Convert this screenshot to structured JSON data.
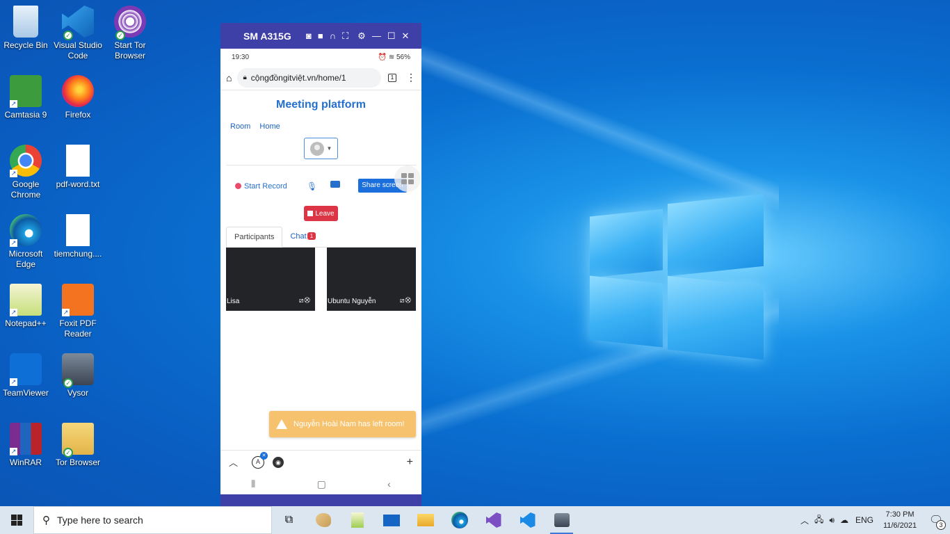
{
  "desktop": {
    "icons": [
      {
        "label": "Recycle Bin",
        "icon": "recycle-bin-icon"
      },
      {
        "label": "Visual Studio Code",
        "icon": "vscode-icon"
      },
      {
        "label": "Start Tor Browser",
        "icon": "tor-browser-icon"
      },
      {
        "label": "Camtasia 9",
        "icon": "camtasia-icon"
      },
      {
        "label": "Firefox",
        "icon": "firefox-icon"
      },
      {
        "label": "Google Chrome",
        "icon": "chrome-icon"
      },
      {
        "label": "pdf-word.txt",
        "icon": "text-file-icon"
      },
      {
        "label": "Microsoft Edge",
        "icon": "edge-icon"
      },
      {
        "label": "tiemchung....",
        "icon": "file-icon"
      },
      {
        "label": "Notepad++",
        "icon": "notepadpp-icon"
      },
      {
        "label": "Foxit PDF Reader",
        "icon": "foxit-icon"
      },
      {
        "label": "TeamViewer",
        "icon": "teamviewer-icon"
      },
      {
        "label": "Vysor",
        "icon": "vysor-icon"
      },
      {
        "label": "WinRAR",
        "icon": "winrar-icon"
      },
      {
        "label": "Tor Browser",
        "icon": "tor-folder-icon"
      }
    ]
  },
  "phone_window": {
    "title": "SM A315G",
    "status": {
      "time": "19:30",
      "battery": "56%"
    },
    "browser": {
      "url": "cộngđồngitviệt.vn/home/1",
      "tab_count": "1"
    },
    "app": {
      "title": "Meeting platform",
      "nav": [
        "Room",
        "Home"
      ],
      "start_record": "Start Record",
      "share_screen": "Share screen",
      "leave": "Leave",
      "tabs": {
        "participants": "Participants",
        "chat": "Chat",
        "chat_badge": "1"
      },
      "participants": [
        {
          "name": "Lisa"
        },
        {
          "name": "Ubuntu Nguyễn"
        }
      ],
      "toast": "Nguyễn Hoài Nam has left room!"
    }
  },
  "taskbar": {
    "search_placeholder": "Type here to search",
    "language": "ENG",
    "time": "7:30 PM",
    "date": "11/6/2021",
    "notification_count": "3"
  }
}
